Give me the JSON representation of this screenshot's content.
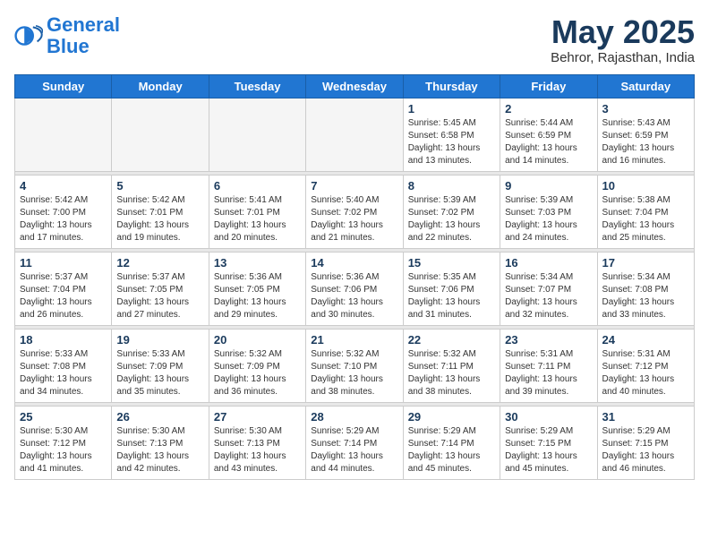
{
  "header": {
    "logo_line1": "General",
    "logo_line2": "Blue",
    "month_year": "May 2025",
    "location": "Behror, Rajasthan, India"
  },
  "days_of_week": [
    "Sunday",
    "Monday",
    "Tuesday",
    "Wednesday",
    "Thursday",
    "Friday",
    "Saturday"
  ],
  "weeks": [
    [
      {
        "day": "",
        "info": ""
      },
      {
        "day": "",
        "info": ""
      },
      {
        "day": "",
        "info": ""
      },
      {
        "day": "",
        "info": ""
      },
      {
        "day": "1",
        "info": "Sunrise: 5:45 AM\nSunset: 6:58 PM\nDaylight: 13 hours\nand 13 minutes."
      },
      {
        "day": "2",
        "info": "Sunrise: 5:44 AM\nSunset: 6:59 PM\nDaylight: 13 hours\nand 14 minutes."
      },
      {
        "day": "3",
        "info": "Sunrise: 5:43 AM\nSunset: 6:59 PM\nDaylight: 13 hours\nand 16 minutes."
      }
    ],
    [
      {
        "day": "4",
        "info": "Sunrise: 5:42 AM\nSunset: 7:00 PM\nDaylight: 13 hours\nand 17 minutes."
      },
      {
        "day": "5",
        "info": "Sunrise: 5:42 AM\nSunset: 7:01 PM\nDaylight: 13 hours\nand 19 minutes."
      },
      {
        "day": "6",
        "info": "Sunrise: 5:41 AM\nSunset: 7:01 PM\nDaylight: 13 hours\nand 20 minutes."
      },
      {
        "day": "7",
        "info": "Sunrise: 5:40 AM\nSunset: 7:02 PM\nDaylight: 13 hours\nand 21 minutes."
      },
      {
        "day": "8",
        "info": "Sunrise: 5:39 AM\nSunset: 7:02 PM\nDaylight: 13 hours\nand 22 minutes."
      },
      {
        "day": "9",
        "info": "Sunrise: 5:39 AM\nSunset: 7:03 PM\nDaylight: 13 hours\nand 24 minutes."
      },
      {
        "day": "10",
        "info": "Sunrise: 5:38 AM\nSunset: 7:04 PM\nDaylight: 13 hours\nand 25 minutes."
      }
    ],
    [
      {
        "day": "11",
        "info": "Sunrise: 5:37 AM\nSunset: 7:04 PM\nDaylight: 13 hours\nand 26 minutes."
      },
      {
        "day": "12",
        "info": "Sunrise: 5:37 AM\nSunset: 7:05 PM\nDaylight: 13 hours\nand 27 minutes."
      },
      {
        "day": "13",
        "info": "Sunrise: 5:36 AM\nSunset: 7:05 PM\nDaylight: 13 hours\nand 29 minutes."
      },
      {
        "day": "14",
        "info": "Sunrise: 5:36 AM\nSunset: 7:06 PM\nDaylight: 13 hours\nand 30 minutes."
      },
      {
        "day": "15",
        "info": "Sunrise: 5:35 AM\nSunset: 7:06 PM\nDaylight: 13 hours\nand 31 minutes."
      },
      {
        "day": "16",
        "info": "Sunrise: 5:34 AM\nSunset: 7:07 PM\nDaylight: 13 hours\nand 32 minutes."
      },
      {
        "day": "17",
        "info": "Sunrise: 5:34 AM\nSunset: 7:08 PM\nDaylight: 13 hours\nand 33 minutes."
      }
    ],
    [
      {
        "day": "18",
        "info": "Sunrise: 5:33 AM\nSunset: 7:08 PM\nDaylight: 13 hours\nand 34 minutes."
      },
      {
        "day": "19",
        "info": "Sunrise: 5:33 AM\nSunset: 7:09 PM\nDaylight: 13 hours\nand 35 minutes."
      },
      {
        "day": "20",
        "info": "Sunrise: 5:32 AM\nSunset: 7:09 PM\nDaylight: 13 hours\nand 36 minutes."
      },
      {
        "day": "21",
        "info": "Sunrise: 5:32 AM\nSunset: 7:10 PM\nDaylight: 13 hours\nand 38 minutes."
      },
      {
        "day": "22",
        "info": "Sunrise: 5:32 AM\nSunset: 7:11 PM\nDaylight: 13 hours\nand 38 minutes."
      },
      {
        "day": "23",
        "info": "Sunrise: 5:31 AM\nSunset: 7:11 PM\nDaylight: 13 hours\nand 39 minutes."
      },
      {
        "day": "24",
        "info": "Sunrise: 5:31 AM\nSunset: 7:12 PM\nDaylight: 13 hours\nand 40 minutes."
      }
    ],
    [
      {
        "day": "25",
        "info": "Sunrise: 5:30 AM\nSunset: 7:12 PM\nDaylight: 13 hours\nand 41 minutes."
      },
      {
        "day": "26",
        "info": "Sunrise: 5:30 AM\nSunset: 7:13 PM\nDaylight: 13 hours\nand 42 minutes."
      },
      {
        "day": "27",
        "info": "Sunrise: 5:30 AM\nSunset: 7:13 PM\nDaylight: 13 hours\nand 43 minutes."
      },
      {
        "day": "28",
        "info": "Sunrise: 5:29 AM\nSunset: 7:14 PM\nDaylight: 13 hours\nand 44 minutes."
      },
      {
        "day": "29",
        "info": "Sunrise: 5:29 AM\nSunset: 7:14 PM\nDaylight: 13 hours\nand 45 minutes."
      },
      {
        "day": "30",
        "info": "Sunrise: 5:29 AM\nSunset: 7:15 PM\nDaylight: 13 hours\nand 45 minutes."
      },
      {
        "day": "31",
        "info": "Sunrise: 5:29 AM\nSunset: 7:15 PM\nDaylight: 13 hours\nand 46 minutes."
      }
    ]
  ]
}
